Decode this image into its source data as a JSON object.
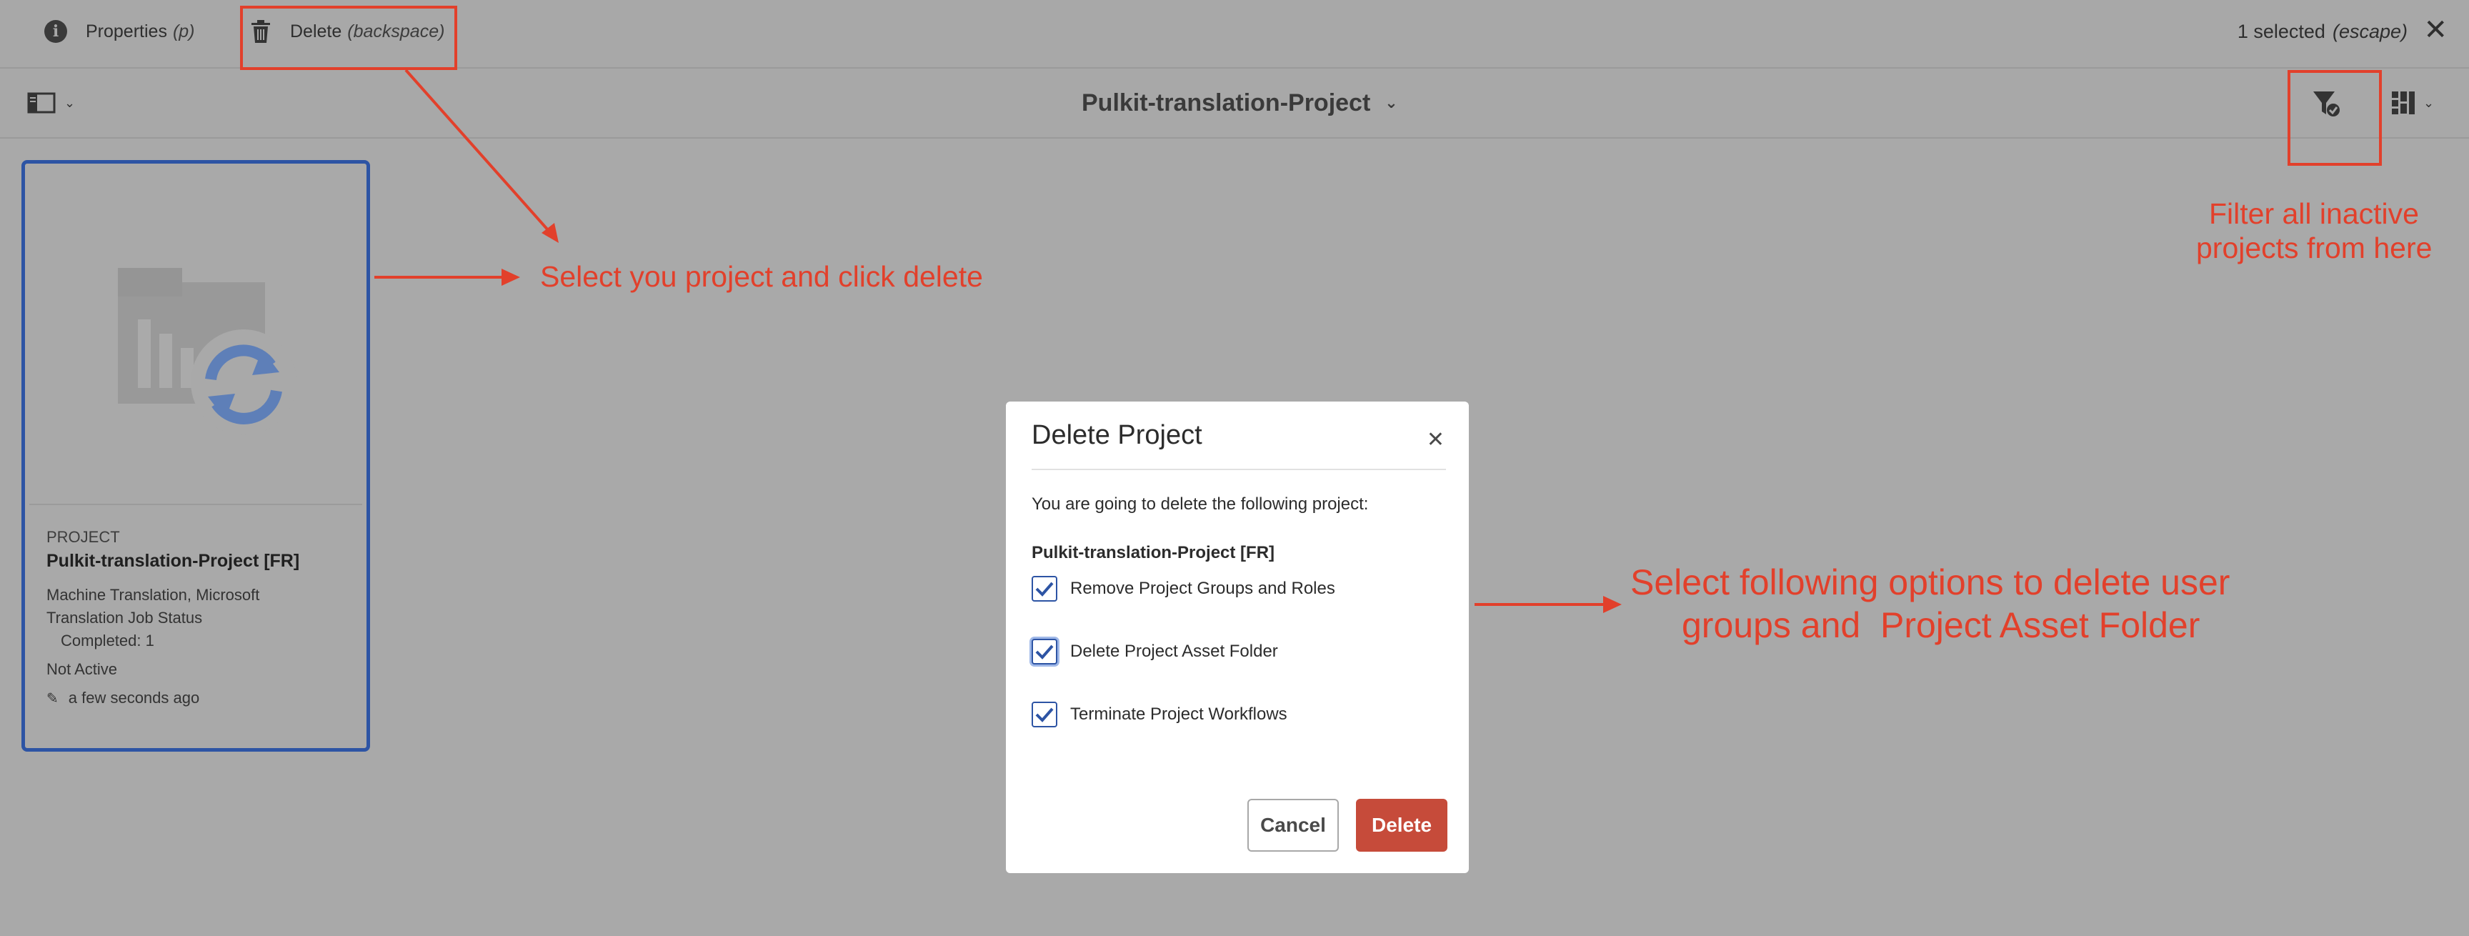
{
  "actionbar": {
    "properties_label": "Properties",
    "properties_shortcut": "(p)",
    "delete_label": "Delete",
    "delete_shortcut": "(backspace)",
    "selected_text": "1 selected",
    "selected_shortcut": "(escape)",
    "close_icon": "close-icon"
  },
  "toolbar": {
    "title": "Pulkit-translation-Project"
  },
  "card": {
    "type": "PROJECT",
    "name": "Pulkit-translation-Project [FR]",
    "description_line1": "Machine Translation, Microsoft",
    "description_line2": "Translation Job Status",
    "completed": "Completed: 1",
    "status": "Not Active",
    "modified": "a few seconds ago"
  },
  "annotations": {
    "select_delete": "Select you project and click delete",
    "filter_line1": "Filter all inactive",
    "filter_line2": "projects from here",
    "options_line1": "Select following options to delete user",
    "options_line2": "groups and  Project Asset Folder"
  },
  "dialog": {
    "title": "Delete Project",
    "message": "You are going to delete the following project:",
    "project_name": "Pulkit-translation-Project [FR]",
    "options": [
      {
        "label": "Remove Project Groups and Roles",
        "checked": true
      },
      {
        "label": "Delete Project Asset Folder",
        "checked": true
      },
      {
        "label": "Terminate Project Workflows",
        "checked": true
      }
    ],
    "cancel_label": "Cancel",
    "delete_label": "Delete"
  },
  "colors": {
    "annotation_red": "#e2402b",
    "selection_blue": "#2d54a4",
    "delete_button": "#c64b3a"
  }
}
